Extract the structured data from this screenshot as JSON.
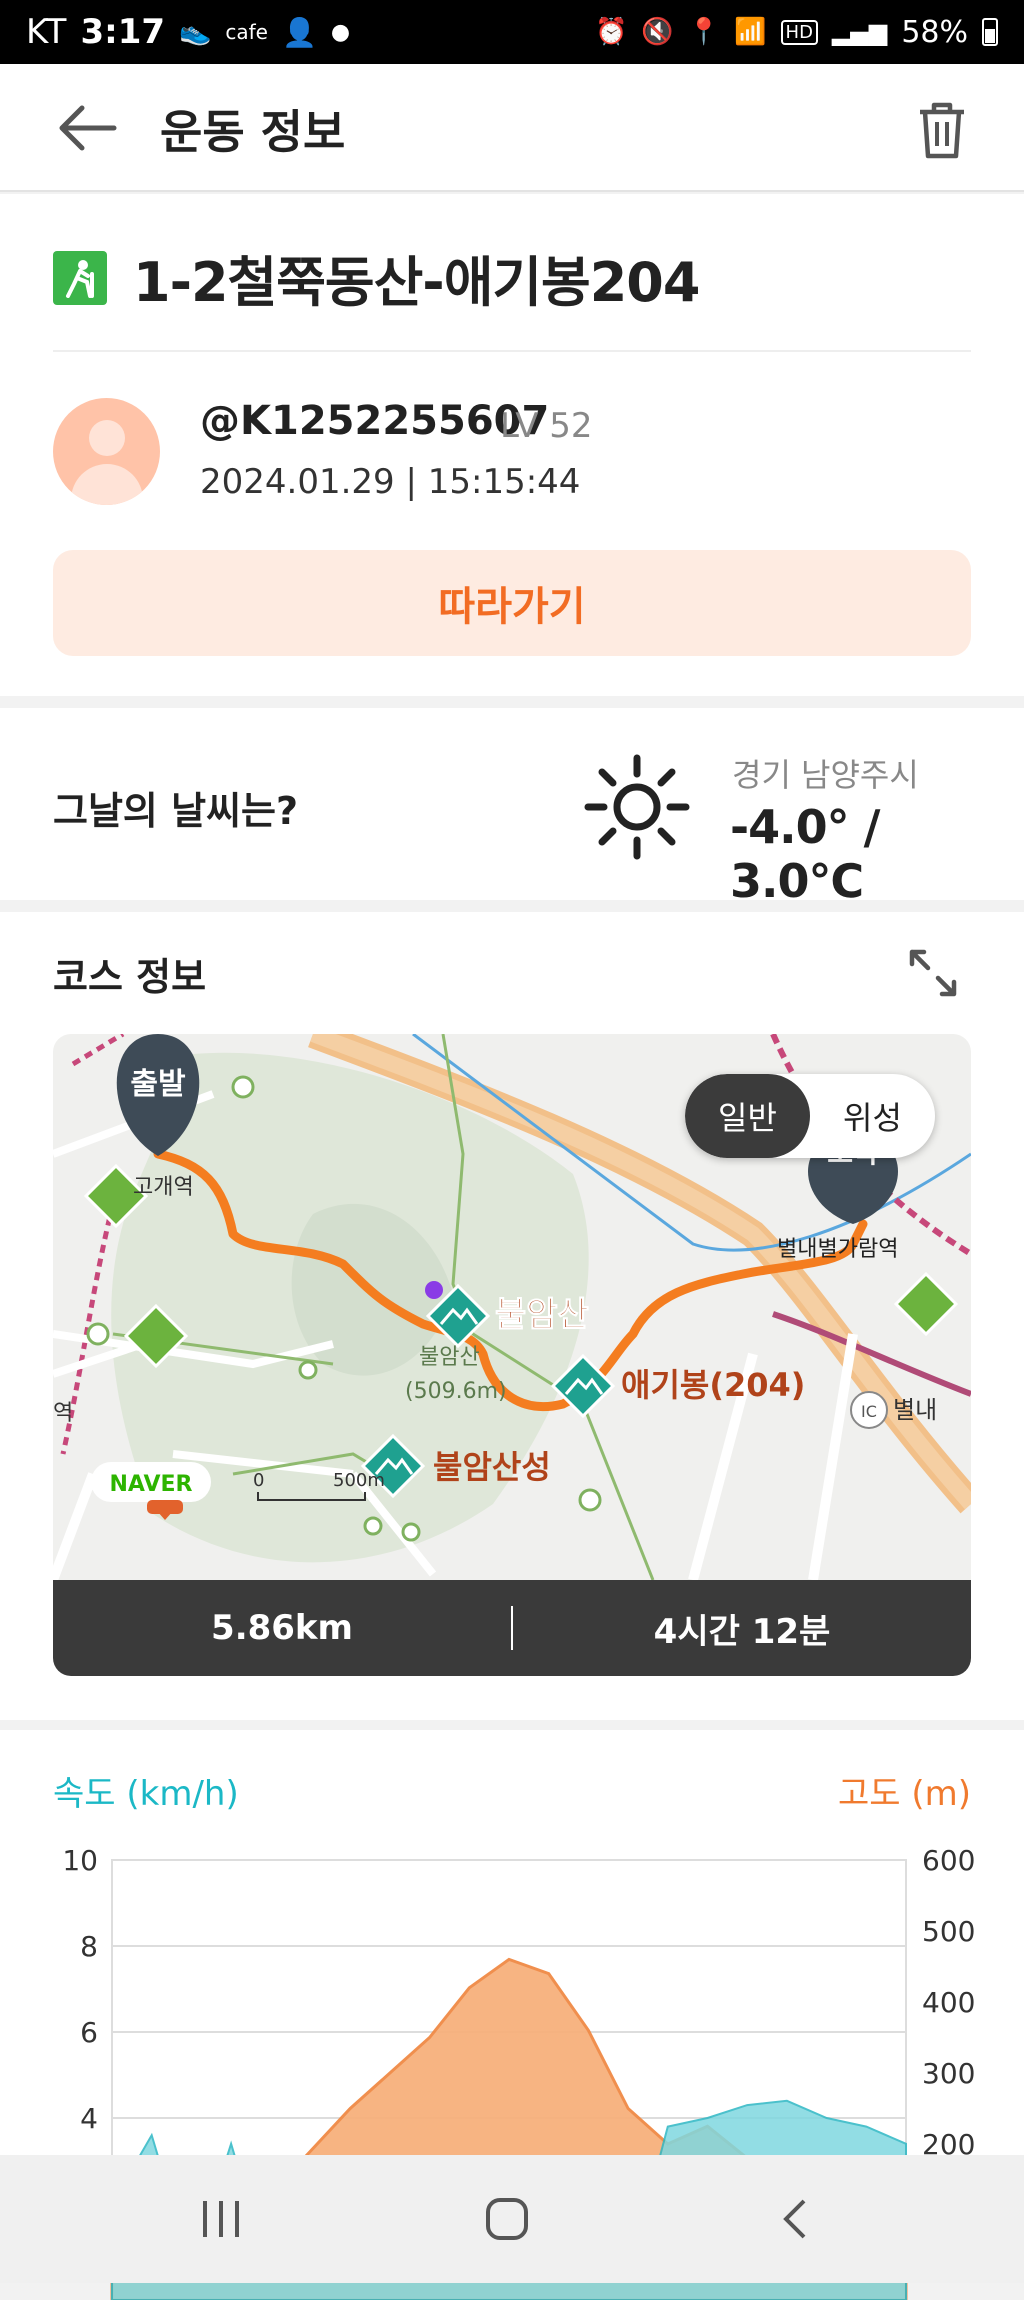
{
  "status_bar": {
    "carrier": "KT",
    "time": "3:17",
    "cafe_label": "cafe",
    "battery": "58%",
    "network": "HD"
  },
  "app_bar": {
    "title": "운동 정보"
  },
  "workout": {
    "title": "1-2철쭉동산-애기봉204",
    "username": "@K1252255607",
    "level": "LV 52",
    "datetime": "2024.01.29 | 15:15:44",
    "follow_label": "따라가기"
  },
  "weather": {
    "question": "그날의 날씨는?",
    "location": "경기 남양주시",
    "temperature": "-4.0° / 3.0℃"
  },
  "course": {
    "section_title": "코스 정보",
    "map": {
      "toggle_general": "일반",
      "toggle_satellite": "위성",
      "start_label": "출발",
      "end_label": "도착",
      "labels": {
        "station_left": "고개역",
        "station_left2": "역",
        "bulamsan": "불암산",
        "bulamsan_small": "불암산",
        "bulamsan_height": "(509.6m)",
        "aegibong": "애기봉(204)",
        "bulamsanseong": "불암산성",
        "byeollae_station": "별내별가람역",
        "byeollae": "별내",
        "ic": "IC",
        "naver": "NAVER",
        "scale_zero": "0",
        "scale_500": "500m"
      }
    },
    "distance": "5.86km",
    "duration": "4시간 12분"
  },
  "chart_labels": {
    "speed": "속도 (km/h)",
    "altitude": "고도 (m)"
  },
  "chart_data": {
    "type": "area",
    "x": [
      0,
      0.05,
      0.1,
      0.15,
      0.2,
      0.25,
      0.3,
      0.35,
      0.4,
      0.45,
      0.5,
      0.55,
      0.6,
      0.65,
      0.7,
      0.75,
      0.8,
      0.85,
      0.9,
      0.95,
      1.0
    ],
    "series": [
      {
        "name": "속도 (km/h)",
        "axis": "left",
        "color": "#7fd8e0",
        "values": [
          2.0,
          3.6,
          0.5,
          3.4,
          0.3,
          0.4,
          0.2,
          0.3,
          0.2,
          0.4,
          2.8,
          0.3,
          0.2,
          0.3,
          3.8,
          4.0,
          4.3,
          4.4,
          4.0,
          3.8,
          3.4
        ]
      },
      {
        "name": "고도 (m)",
        "axis": "right",
        "color": "#f7b07c",
        "values": [
          80,
          90,
          100,
          110,
          130,
          190,
          250,
          300,
          350,
          420,
          460,
          440,
          360,
          250,
          200,
          225,
          180,
          150,
          150,
          150,
          150
        ]
      }
    ],
    "y_left_ticks": [
      4,
      6,
      8,
      10
    ],
    "y_right_ticks": [
      200,
      300,
      400,
      500,
      600
    ],
    "ylim_left": [
      0,
      10
    ],
    "ylim_right": [
      0,
      600
    ],
    "grid": true
  }
}
